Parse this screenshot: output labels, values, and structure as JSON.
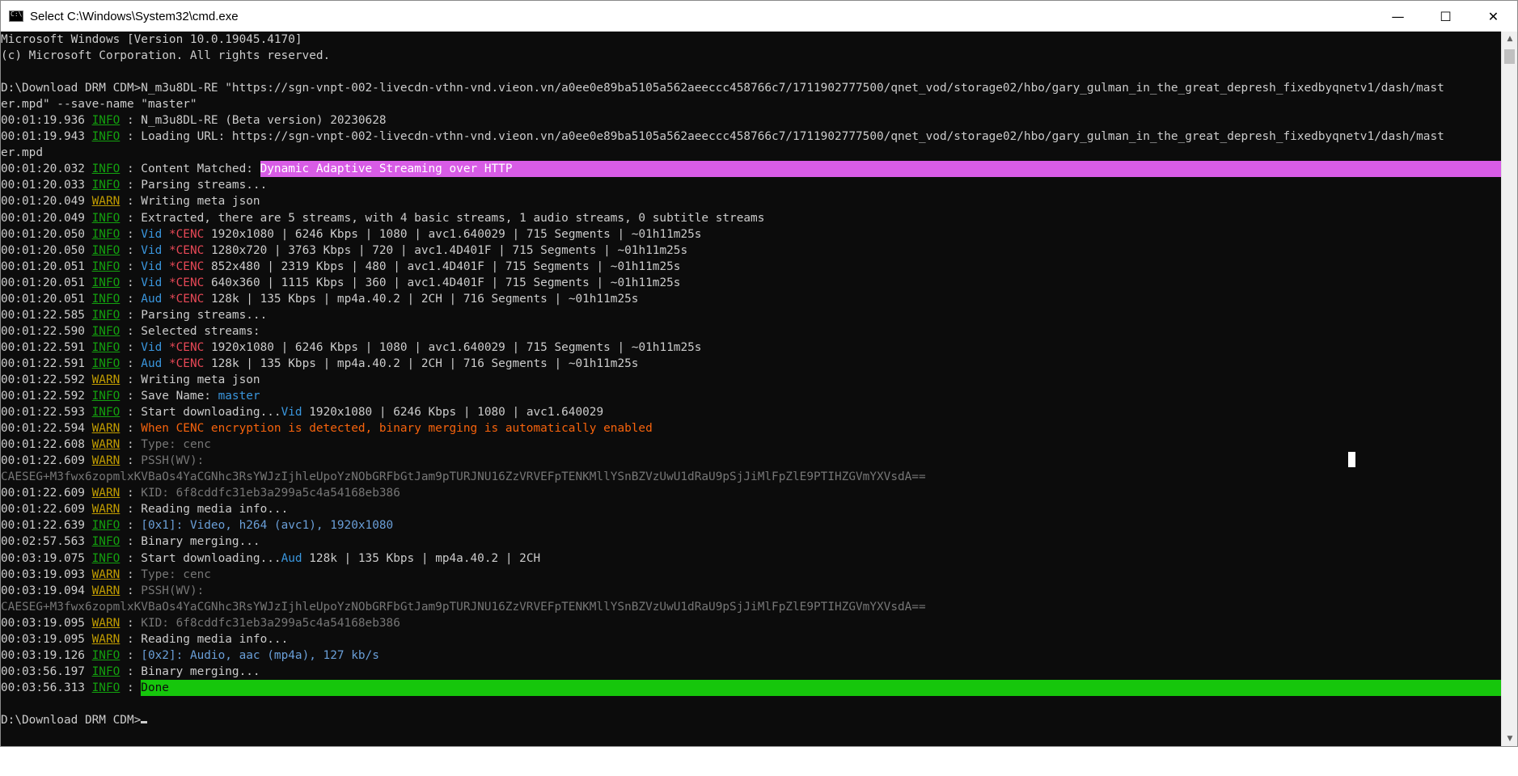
{
  "window": {
    "title": "Select C:\\Windows\\System32\\cmd.exe",
    "minimize_glyph": "—",
    "maximize_glyph": "☐",
    "close_glyph": "✕"
  },
  "colors": {
    "background": "#0c0c0c",
    "default_text": "#cccccc",
    "info": "#13a10e",
    "warn": "#c19c00",
    "cenc": "#e74856",
    "stream_type": "#3a96dd",
    "warning_message": "#f7630c",
    "dim": "#767676",
    "highlight_content": "#d85ce6",
    "highlight_done": "#16c60c"
  },
  "console": {
    "lines": [
      [
        {
          "t": "Microsoft Windows [Version 10.0.19045.4170]"
        }
      ],
      [
        {
          "t": "(c) Microsoft Corporation. All rights reserved."
        }
      ],
      [
        {
          "t": ""
        }
      ],
      [
        {
          "t": "D:\\Download DRM CDM>N_m3u8DL-RE \"https://sgn-vnpt-002-livecdn-vthn-vnd.vieon.vn/a0ee0e89ba5105a562aeeccc458766c7/1711902777500/qnet_vod/storage02/hbo/gary_gulman_in_the_great_depresh_fixedbyqnetv1/dash/mast"
        }
      ],
      [
        {
          "t": "er.mpd\" --save-name \"master\""
        }
      ],
      [
        {
          "t": "00:01:19.936 "
        },
        {
          "t": "INFO",
          "c": "info"
        },
        {
          "t": " : N_m3u8DL-RE (Beta version) 20230628"
        }
      ],
      [
        {
          "t": "00:01:19.943 "
        },
        {
          "t": "INFO",
          "c": "info"
        },
        {
          "t": " : Loading URL: https://sgn-vnpt-002-livecdn-vthn-vnd.vieon.vn/a0ee0e89ba5105a562aeeccc458766c7/1711902777500/qnet_vod/storage02/hbo/gary_gulman_in_the_great_depresh_fixedbyqnetv1/dash/mast"
        }
      ],
      [
        {
          "t": "er.mpd"
        }
      ],
      [
        {
          "t": "00:01:20.032 "
        },
        {
          "t": "INFO",
          "c": "info"
        },
        {
          "t": " : Content Matched: "
        },
        {
          "t": "Dynamic Adaptive Streaming over HTTP",
          "c": "hlmag"
        }
      ],
      [
        {
          "t": "00:01:20.033 "
        },
        {
          "t": "INFO",
          "c": "info"
        },
        {
          "t": " : Parsing streams..."
        }
      ],
      [
        {
          "t": "00:01:20.049 "
        },
        {
          "t": "WARN",
          "c": "warn"
        },
        {
          "t": " : Writing meta json"
        }
      ],
      [
        {
          "t": "00:01:20.049 "
        },
        {
          "t": "INFO",
          "c": "info"
        },
        {
          "t": " : Extracted, there are 5 streams, with 4 basic streams, 1 audio streams, 0 subtitle streams"
        }
      ],
      [
        {
          "t": "00:01:20.050 "
        },
        {
          "t": "INFO",
          "c": "info"
        },
        {
          "t": " : "
        },
        {
          "t": "Vid",
          "c": "blue"
        },
        {
          "t": " "
        },
        {
          "t": "*CENC",
          "c": "red"
        },
        {
          "t": " 1920x1080 | 6246 Kbps | 1080 | avc1.640029 | 715 Segments | ~01h11m25s"
        }
      ],
      [
        {
          "t": "00:01:20.050 "
        },
        {
          "t": "INFO",
          "c": "info"
        },
        {
          "t": " : "
        },
        {
          "t": "Vid",
          "c": "blue"
        },
        {
          "t": " "
        },
        {
          "t": "*CENC",
          "c": "red"
        },
        {
          "t": " 1280x720 | 3763 Kbps | 720 | avc1.4D401F | 715 Segments | ~01h11m25s"
        }
      ],
      [
        {
          "t": "00:01:20.051 "
        },
        {
          "t": "INFO",
          "c": "info"
        },
        {
          "t": " : "
        },
        {
          "t": "Vid",
          "c": "blue"
        },
        {
          "t": " "
        },
        {
          "t": "*CENC",
          "c": "red"
        },
        {
          "t": " 852x480 | 2319 Kbps | 480 | avc1.4D401F | 715 Segments | ~01h11m25s"
        }
      ],
      [
        {
          "t": "00:01:20.051 "
        },
        {
          "t": "INFO",
          "c": "info"
        },
        {
          "t": " : "
        },
        {
          "t": "Vid",
          "c": "blue"
        },
        {
          "t": " "
        },
        {
          "t": "*CENC",
          "c": "red"
        },
        {
          "t": " 640x360 | 1115 Kbps | 360 | avc1.4D401F | 715 Segments | ~01h11m25s"
        }
      ],
      [
        {
          "t": "00:01:20.051 "
        },
        {
          "t": "INFO",
          "c": "info"
        },
        {
          "t": " : "
        },
        {
          "t": "Aud",
          "c": "blue"
        },
        {
          "t": " "
        },
        {
          "t": "*CENC",
          "c": "red"
        },
        {
          "t": " 128k | 135 Kbps | mp4a.40.2 | 2CH | 716 Segments | ~01h11m25s"
        }
      ],
      [
        {
          "t": "00:01:22.585 "
        },
        {
          "t": "INFO",
          "c": "info"
        },
        {
          "t": " : Parsing streams..."
        }
      ],
      [
        {
          "t": "00:01:22.590 "
        },
        {
          "t": "INFO",
          "c": "info"
        },
        {
          "t": " : Selected streams:"
        }
      ],
      [
        {
          "t": "00:01:22.591 "
        },
        {
          "t": "INFO",
          "c": "info"
        },
        {
          "t": " : "
        },
        {
          "t": "Vid",
          "c": "blue"
        },
        {
          "t": " "
        },
        {
          "t": "*CENC",
          "c": "red"
        },
        {
          "t": " 1920x1080 | 6246 Kbps | 1080 | avc1.640029 | 715 Segments | ~01h11m25s"
        }
      ],
      [
        {
          "t": "00:01:22.591 "
        },
        {
          "t": "INFO",
          "c": "info"
        },
        {
          "t": " : "
        },
        {
          "t": "Aud",
          "c": "blue"
        },
        {
          "t": " "
        },
        {
          "t": "*CENC",
          "c": "red"
        },
        {
          "t": " 128k | 135 Kbps | mp4a.40.2 | 2CH | 716 Segments | ~01h11m25s"
        }
      ],
      [
        {
          "t": "00:01:22.592 "
        },
        {
          "t": "WARN",
          "c": "warn"
        },
        {
          "t": " : Writing meta json"
        }
      ],
      [
        {
          "t": "00:01:22.592 "
        },
        {
          "t": "INFO",
          "c": "info"
        },
        {
          "t": " : Save Name: "
        },
        {
          "t": "master",
          "c": "blue"
        }
      ],
      [
        {
          "t": "00:01:22.593 "
        },
        {
          "t": "INFO",
          "c": "info"
        },
        {
          "t": " : Start downloading..."
        },
        {
          "t": "Vid",
          "c": "blue"
        },
        {
          "t": " 1920x1080 | 6246 Kbps | 1080 | avc1.640029"
        }
      ],
      [
        {
          "t": "00:01:22.594 "
        },
        {
          "t": "WARN",
          "c": "warn"
        },
        {
          "t": " : "
        },
        {
          "t": "When CENC encryption is detected, binary merging is automatically enabled",
          "c": "orange"
        }
      ],
      [
        {
          "t": "00:01:22.608 "
        },
        {
          "t": "WARN",
          "c": "warn"
        },
        {
          "t": " : "
        },
        {
          "t": "Type: cenc",
          "c": "gray"
        }
      ],
      [
        {
          "t": "00:01:22.609 "
        },
        {
          "t": "WARN",
          "c": "warn"
        },
        {
          "t": " : "
        },
        {
          "t": "PSSH(WV):",
          "c": "gray"
        }
      ],
      [
        {
          "t": "CAESEG+M3fwx6zopmlxKVBaOs4YaCGNhc3RsYWJzIjhleUpoYzNObGRFbGtJam9pTURJNU16ZzVRVEFpTENKMllYSnBZVzUwU1dRaU9pSjJiMlFpZlE9PTIHZGVmYXVsdA==",
          "c": "gray"
        }
      ],
      [
        {
          "t": "00:01:22.609 "
        },
        {
          "t": "WARN",
          "c": "warn"
        },
        {
          "t": " : "
        },
        {
          "t": "KID: 6f8cddfc31eb3a299a5c4a54168eb386",
          "c": "gray"
        }
      ],
      [
        {
          "t": "00:01:22.609 "
        },
        {
          "t": "WARN",
          "c": "warn"
        },
        {
          "t": " : Reading media info..."
        }
      ],
      [
        {
          "t": "00:01:22.639 "
        },
        {
          "t": "INFO",
          "c": "info"
        },
        {
          "t": " : "
        },
        {
          "t": "[0x1]: Video, h264 (avc1), 1920x1080",
          "c": "lblue"
        }
      ],
      [
        {
          "t": "00:02:57.563 "
        },
        {
          "t": "INFO",
          "c": "info"
        },
        {
          "t": " : Binary merging..."
        }
      ],
      [
        {
          "t": "00:03:19.075 "
        },
        {
          "t": "INFO",
          "c": "info"
        },
        {
          "t": " : Start downloading..."
        },
        {
          "t": "Aud",
          "c": "blue"
        },
        {
          "t": " 128k | 135 Kbps | mp4a.40.2 | 2CH"
        }
      ],
      [
        {
          "t": "00:03:19.093 "
        },
        {
          "t": "WARN",
          "c": "warn"
        },
        {
          "t": " : "
        },
        {
          "t": "Type: cenc",
          "c": "gray"
        }
      ],
      [
        {
          "t": "00:03:19.094 "
        },
        {
          "t": "WARN",
          "c": "warn"
        },
        {
          "t": " : "
        },
        {
          "t": "PSSH(WV):",
          "c": "gray"
        }
      ],
      [
        {
          "t": "CAESEG+M3fwx6zopmlxKVBaOs4YaCGNhc3RsYWJzIjhleUpoYzNObGRFbGtJam9pTURJNU16ZzVRVEFpTENKMllYSnBZVzUwU1dRaU9pSjJiMlFpZlE9PTIHZGVmYXVsdA==",
          "c": "gray"
        }
      ],
      [
        {
          "t": "00:03:19.095 "
        },
        {
          "t": "WARN",
          "c": "warn"
        },
        {
          "t": " : "
        },
        {
          "t": "KID: 6f8cddfc31eb3a299a5c4a54168eb386",
          "c": "gray"
        }
      ],
      [
        {
          "t": "00:03:19.095 "
        },
        {
          "t": "WARN",
          "c": "warn"
        },
        {
          "t": " : Reading media info..."
        }
      ],
      [
        {
          "t": "00:03:19.126 "
        },
        {
          "t": "INFO",
          "c": "info"
        },
        {
          "t": " : "
        },
        {
          "t": "[0x2]: Audio, aac (mp4a), 127 kb/s",
          "c": "lblue"
        }
      ],
      [
        {
          "t": "00:03:56.197 "
        },
        {
          "t": "INFO",
          "c": "info"
        },
        {
          "t": " : Binary merging..."
        }
      ],
      [
        {
          "t": "00:03:56.313 "
        },
        {
          "t": "INFO",
          "c": "info"
        },
        {
          "t": " : "
        },
        {
          "t": "Done",
          "c": "hlgreen"
        }
      ],
      [
        {
          "t": ""
        }
      ],
      [
        {
          "t": "D:\\Download DRM CDM>"
        }
      ]
    ],
    "full_width_highlight_rows": {
      "8": "#d85ce6",
      "40": "#16c60c"
    }
  },
  "scrollbar": {
    "up_icon": "▲",
    "down_icon": "▼"
  }
}
